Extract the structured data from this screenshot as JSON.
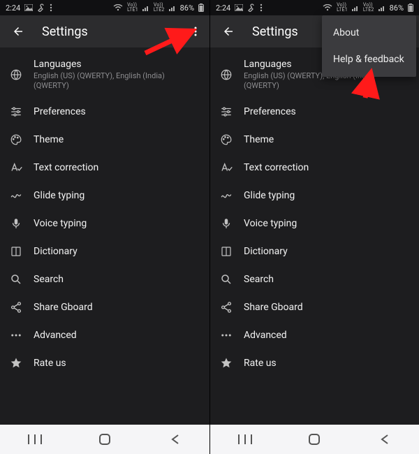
{
  "status": {
    "time": "2:24",
    "battery_pct": "86%",
    "lte1": "Vo))\nLTE1",
    "lte2": "Vo))\nLTE2"
  },
  "appbar": {
    "title": "Settings"
  },
  "items": {
    "languages": {
      "label": "Languages",
      "sub": "English (US) (QWERTY), English (India) (QWERTY)"
    },
    "preferences": {
      "label": "Preferences"
    },
    "theme": {
      "label": "Theme"
    },
    "textcorrection": {
      "label": "Text correction"
    },
    "glide": {
      "label": "Glide typing"
    },
    "voice": {
      "label": "Voice typing"
    },
    "dictionary": {
      "label": "Dictionary"
    },
    "search": {
      "label": "Search"
    },
    "share": {
      "label": "Share Gboard"
    },
    "advanced": {
      "label": "Advanced"
    },
    "rate": {
      "label": "Rate us"
    }
  },
  "popup": {
    "about": "About",
    "help": "Help & feedback"
  }
}
